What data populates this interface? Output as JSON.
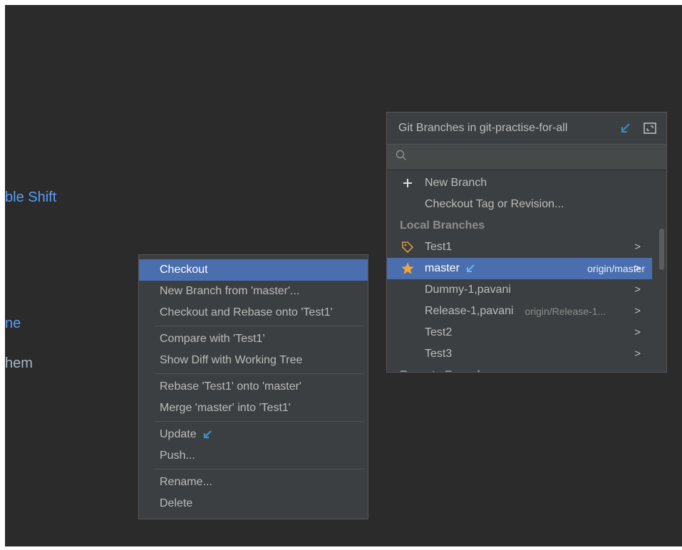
{
  "editor": {
    "hints": [
      "ble Shift",
      "ne",
      "hem"
    ]
  },
  "branches_popup": {
    "title": "Git Branches in git-practise-for-all",
    "search_placeholder": "",
    "actions": [
      {
        "label": "New Branch",
        "icon": "plus-icon"
      },
      {
        "label": "Checkout Tag or Revision..."
      }
    ],
    "local_section": "Local Branches",
    "local_branches": [
      {
        "name": "Test1",
        "icon": "tag-icon",
        "tracking": ""
      },
      {
        "name": "master",
        "icon": "star-icon",
        "tracking": "origin/master",
        "selected": true,
        "incoming": true
      },
      {
        "name": "Dummy-1,pavani",
        "tracking": ""
      },
      {
        "name": "Release-1,pavani",
        "tracking": "origin/Release-1..."
      },
      {
        "name": "Test2",
        "tracking": ""
      },
      {
        "name": "Test3",
        "tracking": ""
      }
    ],
    "remote_section": "Remote Branches",
    "colors": {
      "selection": "#4b6eaf",
      "star": "#f0a732",
      "tag": "#d59b41",
      "update_arrow": "#3592c4"
    }
  },
  "context_menu": {
    "groups": [
      [
        "Checkout",
        "New Branch from 'master'...",
        "Checkout and Rebase onto 'Test1'"
      ],
      [
        "Compare with 'Test1'",
        "Show Diff with Working Tree"
      ],
      [
        "Rebase 'Test1' onto 'master'",
        "Merge 'master' into 'Test1'"
      ],
      [
        "Update",
        "Push..."
      ],
      [
        "Rename...",
        "Delete"
      ]
    ],
    "selected": "Checkout",
    "update_icon": "incoming-arrow-icon"
  }
}
